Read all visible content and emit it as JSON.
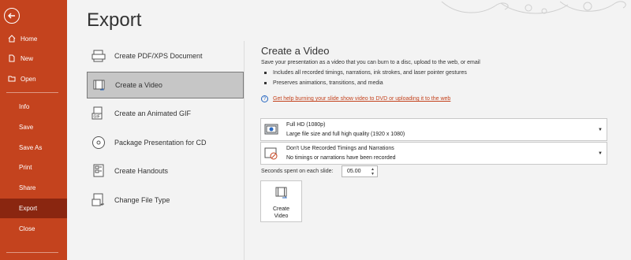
{
  "sidebar": {
    "items": [
      {
        "label": "Home",
        "icon": "home-icon"
      },
      {
        "label": "New",
        "icon": "new-document-icon"
      },
      {
        "label": "Open",
        "icon": "folder-open-icon"
      },
      {
        "label": "Info"
      },
      {
        "label": "Save"
      },
      {
        "label": "Save As"
      },
      {
        "label": "Print"
      },
      {
        "label": "Share"
      },
      {
        "label": "Export"
      },
      {
        "label": "Close"
      }
    ],
    "active": "Export",
    "accent_color": "#c4431e",
    "active_color": "#8a2610"
  },
  "main": {
    "title": "Export",
    "options": [
      {
        "label": "Create PDF/XPS Document",
        "icon": "pdf-document-icon"
      },
      {
        "label": "Create a Video",
        "icon": "video-film-icon"
      },
      {
        "label": "Create an Animated GIF",
        "icon": "gif-icon"
      },
      {
        "label": "Package Presentation for CD",
        "icon": "cd-disc-icon"
      },
      {
        "label": "Create Handouts",
        "icon": "handouts-icon"
      },
      {
        "label": "Change File Type",
        "icon": "file-type-icon"
      }
    ],
    "selected_option": "Create a Video"
  },
  "panel": {
    "title": "Create a Video",
    "description": "Save your presentation as a video that you can burn to a disc, upload to the web, or email",
    "bullets": [
      "Includes all recorded timings, narrations, ink strokes, and laser pointer gestures",
      "Preserves animations, transitions, and media"
    ],
    "help_link": "Get help burning your slide show video to DVD or uploading it to the web",
    "quality_dropdown": {
      "line1": "Full HD (1080p)",
      "line2": "Large file size and full high quality (1920 x 1080)"
    },
    "timings_dropdown": {
      "line1": "Don't Use Recorded Timings and Narrations",
      "line2": "No timings or narrations have been recorded"
    },
    "seconds_label": "Seconds spent on each slide:",
    "seconds_value": "05.00",
    "create_button": {
      "line1": "Create",
      "line2": "Video"
    }
  }
}
